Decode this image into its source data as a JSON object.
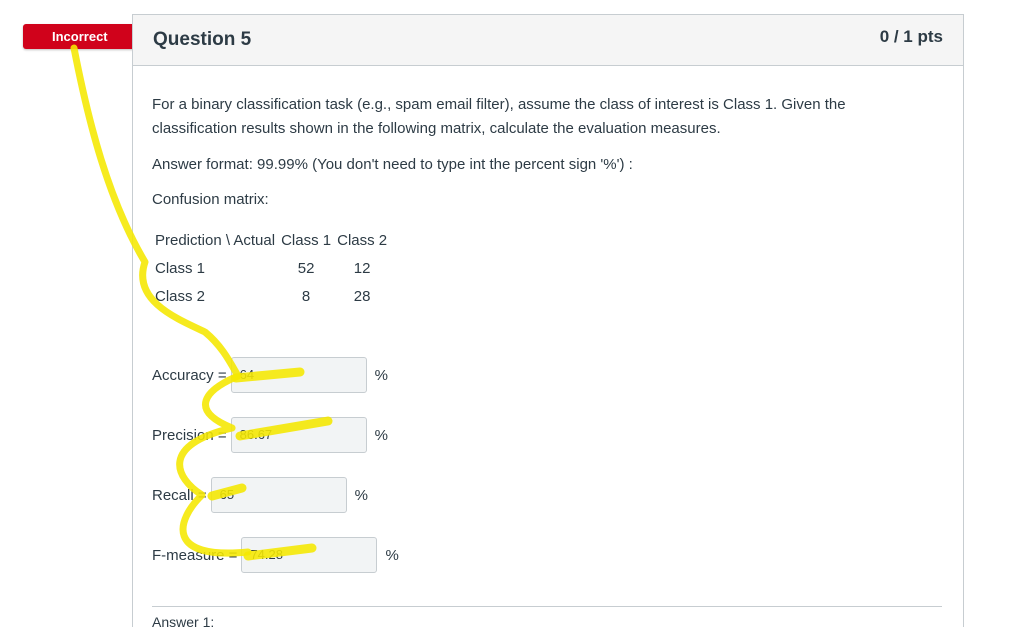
{
  "status": {
    "label": "Incorrect",
    "color": "#d0021b"
  },
  "question": {
    "title": "Question 5",
    "points": "0 / 1 pts",
    "prompt": "For a binary classification task (e.g., spam email filter), assume the class of interest is Class 1. Given the classification results shown in the following matrix, calculate the evaluation measures.",
    "format_note": "Answer format: 99.99% (You don't need to type int the percent sign '%') :",
    "matrix_heading": "Confusion matrix:"
  },
  "matrix": {
    "header": [
      "Prediction \\ Actual",
      "Class 1",
      "Class 2"
    ],
    "rows": [
      [
        "Class 1",
        "52",
        "12"
      ],
      [
        "Class 2",
        "8",
        "28"
      ]
    ]
  },
  "answers": {
    "accuracy": {
      "label": "Accuracy =",
      "value": "64",
      "unit": "%"
    },
    "precision": {
      "label": "Precision =",
      "value": "86.67",
      "unit": "%"
    },
    "recall": {
      "label": "Recall =",
      "value": "65",
      "unit": "%"
    },
    "fmeasure": {
      "label": "F-measure =",
      "value": "74.28",
      "unit": "%"
    }
  },
  "footer": {
    "answer_peek": "Answer 1:"
  },
  "colors": {
    "highlighter": "#f5e800",
    "field_bg": "#f2f4f5",
    "border": "#c7cdd1"
  }
}
